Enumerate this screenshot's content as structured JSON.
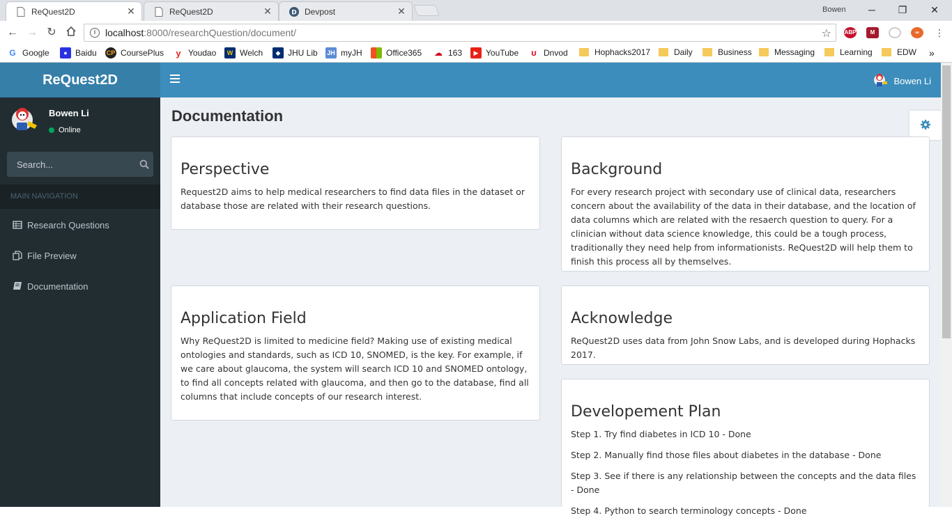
{
  "browser": {
    "tabs": [
      {
        "title": "ReQuest2D",
        "active": true
      },
      {
        "title": "ReQuest2D",
        "active": false
      },
      {
        "title": "Devpost",
        "active": false
      }
    ],
    "profile_name": "Bowen",
    "url_host": "localhost",
    "url_path": ":8000/researchQuestion/document/",
    "bookmarks": [
      "Google",
      "Baidu",
      "CoursePlus",
      "Youdao",
      "Welch",
      "JHU Lib",
      "myJH",
      "Office365",
      "163",
      "YouTube",
      "Dnvod",
      "Hophacks2017",
      "Daily",
      "Business",
      "Messaging",
      "Learning",
      "EDW"
    ],
    "more_bookmarks": "»"
  },
  "app": {
    "logo": "ReQuest2D",
    "user_name": "Bowen Li",
    "status": "Online",
    "search_placeholder": "Search...",
    "nav_header": "MAIN NAVIGATION",
    "nav": [
      "Research Questions",
      "File Preview",
      "Documentation"
    ]
  },
  "page": {
    "title": "Documentation",
    "boxes": {
      "perspective": {
        "title": "Perspective",
        "body": "Request2D aims to help medical researchers to find data files in the dataset or database those are related with their research questions."
      },
      "background": {
        "title": "Background",
        "body": "For every research project with secondary use of clinical data, researchers concern about the availability of the data in their database, and the location of data columns which are related with the resaerch question to query. For a clinician without data science knowledge, this could be a tough process, traditionally they need help from informationists. ReQuest2D will help them to finish this process all by themselves."
      },
      "application": {
        "title": "Application Field",
        "body": "Why ReQuest2D is limited to medicine field? Making use of existing medical ontologies and standards, such as ICD 10, SNOMED, is the key. For example, if we care about glaucoma, the system will search ICD 10 and SNOMED ontology, to find all concepts related with glaucoma, and then go to the database, find all columns that include concepts of our research interest."
      },
      "acknowledge": {
        "title": "Acknowledge",
        "body": "ReQuest2D uses data from John Snow Labs, and is developed during Hophacks 2017."
      },
      "plan": {
        "title": "Developement Plan",
        "steps": [
          "Step 1. Try find diabetes in ICD 10 - Done",
          "Step 2. Manually find those files about diabetes in the database - Done",
          "Step 3. See if there is any relationship between the concepts and the data files - Done",
          "Step 4. Python to search terminology concepts - Done"
        ]
      }
    }
  }
}
